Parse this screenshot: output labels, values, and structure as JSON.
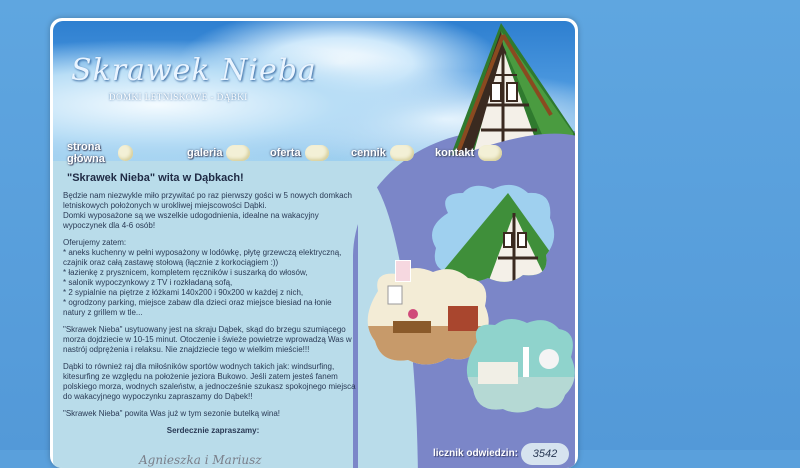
{
  "site": {
    "logo_text": "Skrawek Nieba",
    "subtitle": "DOMKI LETNISKOWE - DĄBKI"
  },
  "nav": {
    "items": [
      {
        "label": "strona główna"
      },
      {
        "label": "galeria"
      },
      {
        "label": "oferta"
      },
      {
        "label": "cennik"
      },
      {
        "label": "kontakt"
      }
    ]
  },
  "content": {
    "heading": "\"Skrawek Nieba\" wita w Dąbkach!",
    "intro": "      Będzie nam niezwykle miło przywitać po raz pierwszy gości w 5 nowych domkach letniskowych położonych w urokliwej miejscowości Dąbki.",
    "intro2": "Domki wyposażone są we wszelkie udogodnienia, idealne na wakacyjny wypoczynek dla 4-6 osób!",
    "offer_title": "Oferujemy zatem:",
    "offer_1": "* aneks kuchenny w pełni wyposażony w  lodówkę, płytę grzewczą elektryczną,",
    "offer_1b": "   czajnik oraz całą zastawę stołową (łącznie z korkociągiem :))",
    "offer_2": "* łazienkę z prysznicem, kompletem ręczników i suszarką do włosów,",
    "offer_3": "* salonik wypoczynkowy z TV i rozkładaną sofą,",
    "offer_4": "* 2 sypialnie na piętrze z łóżkami  140x200 i 90x200 w każdej z nich,",
    "offer_5": "* ogrodzony parking, miejsce zabaw dla dzieci  oraz  miejsce biesiad na łonie",
    "offer_5b": "   natury z grillem w tle...",
    "para2": "      \"Skrawek Nieba\" usytuowany jest na skraju Dąbek, skąd do brzegu szumiącego morza dojdziecie  w 10-15 minut. Otoczenie i świeże powietrze wprowadzą Was w nastrój odprężenia i relaksu. Nie znajdziecie tego w wielkim mieście!!!",
    "para3": "      Dąbki to również raj dla miłośników sportów wodnych takich jak: windsurfing, kitesurfing ze względu na położenie  jeziora Bukowo. Jeśli zatem jesteś fanem polskiego morza, wodnych szaleństw, a jednocześnie szukasz spokojnego miejsca do wakacyjnego wypoczynku zapraszamy do Dąbek!!",
    "para4": "\"Skrawek Nieba\" powita Was już w tym sezonie butelką wina!",
    "closing": "Serdecznie zapraszamy:",
    "signature": "Agnieszka i Mariusz"
  },
  "counter": {
    "label": "licznik odwiedzin:",
    "value": "3542"
  },
  "colors": {
    "page_bg": "#5aa0dc",
    "content_bg": "#b9dcea",
    "purple_panel": "#7b86c8",
    "roof_green": "#3f8f3a"
  }
}
